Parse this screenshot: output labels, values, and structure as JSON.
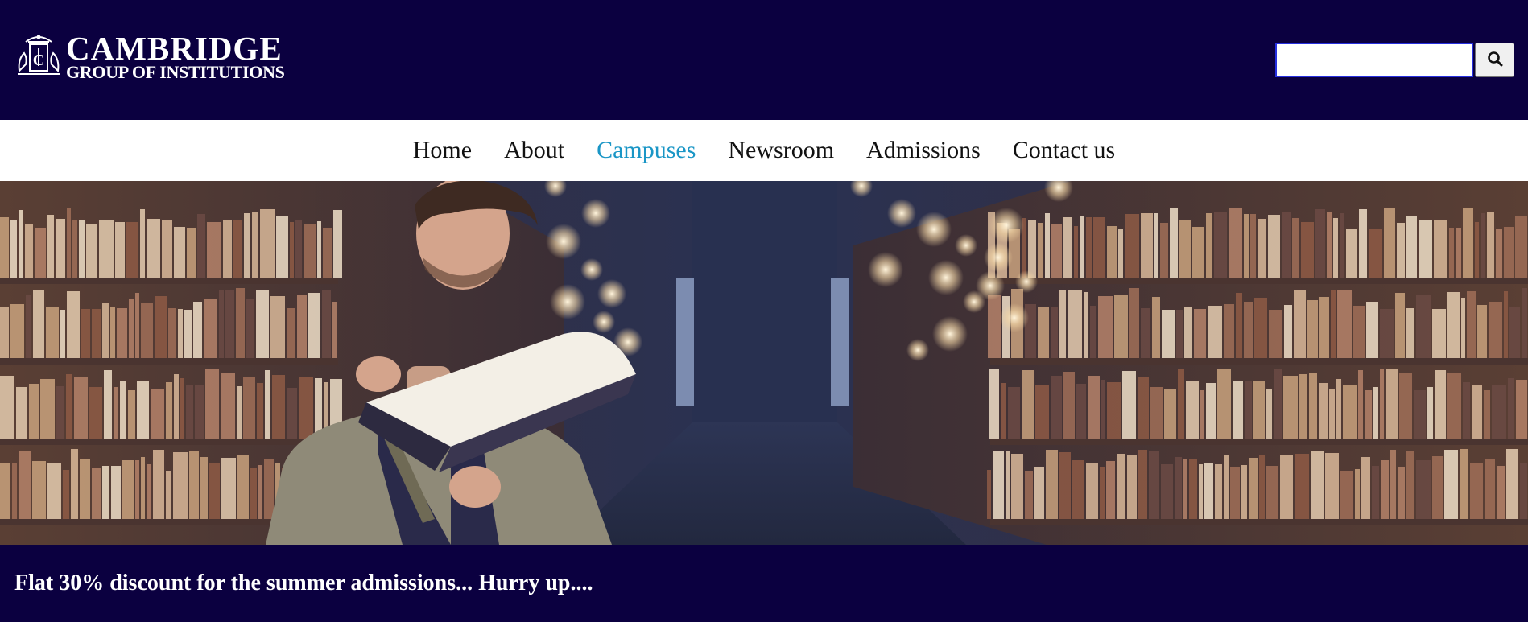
{
  "header": {
    "logo": {
      "main": "CAMBRIDGE",
      "sub": "GROUP OF INSTITUTIONS",
      "icon": "crest-icon"
    },
    "search": {
      "value": "",
      "placeholder": "",
      "button_icon": "search-icon"
    }
  },
  "nav": {
    "items": [
      {
        "label": "Home"
      },
      {
        "label": "About"
      },
      {
        "label": "Campuses",
        "active": true
      },
      {
        "label": "Newsroom"
      },
      {
        "label": "Admissions"
      },
      {
        "label": "Contact us"
      }
    ],
    "active_color": "#1a96c6"
  },
  "hero": {
    "image": "student reading a book in a library aisle"
  },
  "banner": {
    "text": "Flat 30% discount for the summer admissions... Hurry up...."
  },
  "colors": {
    "header_bg": "#0b0040",
    "nav_bg": "#ffffff",
    "text_dark": "#111111"
  }
}
